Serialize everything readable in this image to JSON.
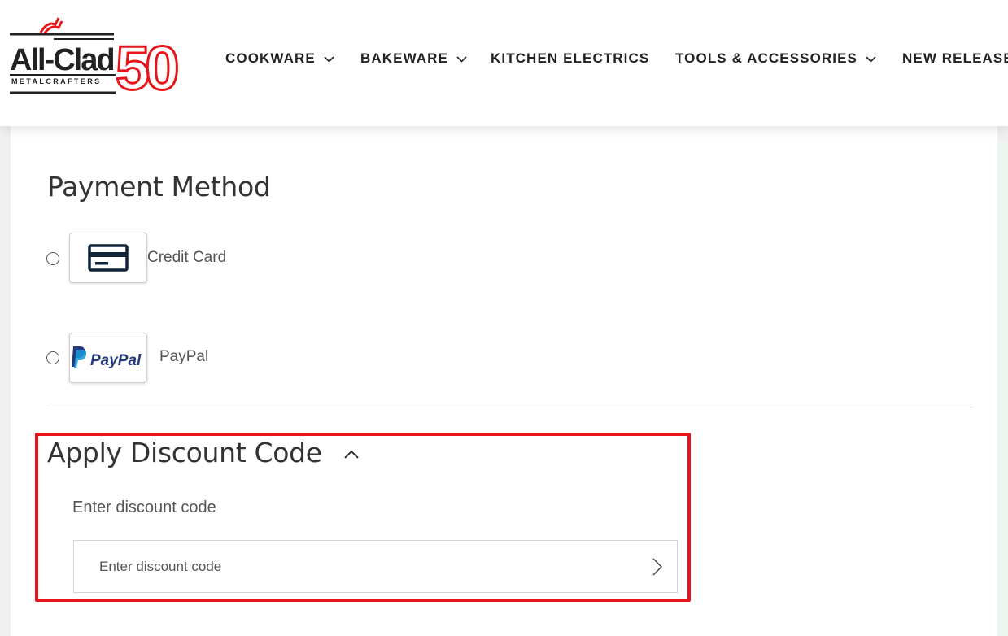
{
  "header": {
    "logo": {
      "brand": "All-Clad",
      "tagline": "METALCRAFTERS",
      "anniversary": "50",
      "brand_color": "#e8141b"
    },
    "nav": [
      {
        "label": "COOKWARE",
        "has_dropdown": true
      },
      {
        "label": "BAKEWARE",
        "has_dropdown": true
      },
      {
        "label": "KITCHEN ELECTRICS",
        "has_dropdown": false
      },
      {
        "label": "TOOLS & ACCESSORIES",
        "has_dropdown": true
      },
      {
        "label": "NEW RELEASE",
        "has_dropdown": false
      }
    ]
  },
  "payment": {
    "title": "Payment Method",
    "options": [
      {
        "label": "Credit Card",
        "icon": "credit-card-icon",
        "selected": false
      },
      {
        "label": "PayPal",
        "icon": "paypal-logo",
        "logo_text": "PayPal",
        "selected": false
      }
    ]
  },
  "discount": {
    "title": "Apply Discount Code",
    "expanded": true,
    "label": "Enter discount code",
    "placeholder": "Enter discount code",
    "value": "",
    "highlight_color": "#e8141b"
  }
}
